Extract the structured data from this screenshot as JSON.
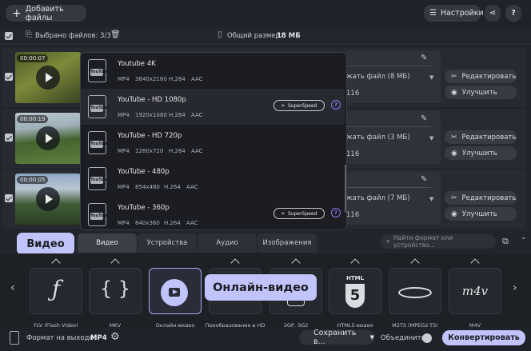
{
  "header": {
    "add_files": "Добавить файлы",
    "settings": "Настройки",
    "help": "?"
  },
  "selection": {
    "selected": "Выбрано файлов: 3/3",
    "total_label": "Общий размер:",
    "total_value": "18 МБ"
  },
  "files": [
    {
      "duration": "00:00:07",
      "file_size": "жать файл (8 МБ)",
      "bitrate": "116"
    },
    {
      "duration": "00:00:19",
      "file_size": "жать файл (3 МБ)",
      "bitrate": "116"
    },
    {
      "duration": "00:00:05",
      "file_size": "жать файл (7 МБ)",
      "bitrate": "116"
    }
  ],
  "file_actions": {
    "edit": "Редактировать",
    "enhance": "Улучшить"
  },
  "presets": [
    {
      "name": "Youtube 4K",
      "container": "MP4",
      "resolution": "3840x2160",
      "vcodec": "H.264",
      "acodec": "AAC",
      "superspeed": ""
    },
    {
      "name": "YouTube - HD 1080p",
      "container": "MP4",
      "resolution": "1920x1080",
      "vcodec": "H.264",
      "acodec": "AAC",
      "superspeed": "SuperSpeed"
    },
    {
      "name": "YouTube - HD 720p",
      "container": "MP4",
      "resolution": "1280x720",
      "vcodec": "H.264",
      "acodec": "AAC",
      "superspeed": ""
    },
    {
      "name": "YouTube - 480p",
      "container": "MP4",
      "resolution": "854x480",
      "vcodec": "H.264",
      "acodec": "AAC",
      "superspeed": ""
    },
    {
      "name": "YouTube - 360p",
      "container": "MP4",
      "resolution": "640x360",
      "vcodec": "H.264",
      "acodec": "AAC",
      "superspeed": "SuperSpeed"
    }
  ],
  "preset_icon_label": "YouTube",
  "tabs": [
    "Видео",
    "Устройства",
    "Аудио",
    "Изображения"
  ],
  "tooltips": {
    "video": "Видео",
    "online_video": "Онлайн-видео"
  },
  "search": {
    "placeholder": "Найти формат или устройство..."
  },
  "formats": [
    {
      "label": "FLV (Flash Video)",
      "icon": "flash-icon"
    },
    {
      "label": "MKV",
      "icon": "braces-icon"
    },
    {
      "label": "Онлайн-видео",
      "icon": "online-video-icon",
      "selected": true
    },
    {
      "label": "Преобразование в HD",
      "icon": "hd-icon"
    },
    {
      "label": "3GP, 3G2",
      "icon": "mobile-icon"
    },
    {
      "label": "HTML5-видео",
      "icon": "html5-icon"
    },
    {
      "label": "M2TS (MPEG2-TS)",
      "icon": "bluray-icon"
    },
    {
      "label": "M4V",
      "icon": "m4v-icon"
    }
  ],
  "format_glyphs": {
    "html": "HTML",
    "five": "5",
    "m4v": "m4v"
  },
  "footer": {
    "output_label": "Формат на выходе:",
    "output_value": "MP4",
    "save_to": "Сохранить в...",
    "merge": "Объединить:",
    "convert": "Конвертировать"
  },
  "colors": {
    "accent": "#c0c4fb",
    "background": "#22252b",
    "dropdown": "#1b1d22"
  }
}
